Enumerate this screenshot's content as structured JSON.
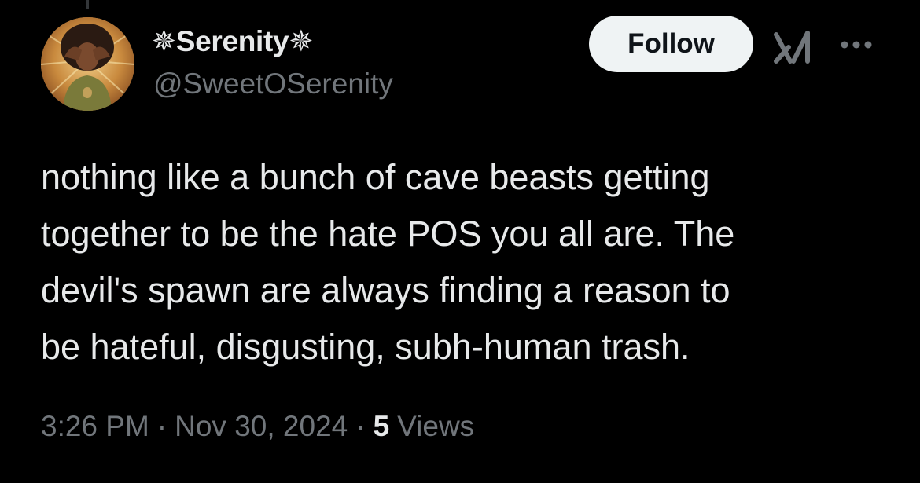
{
  "author": {
    "display_name": "✵Serenity✵",
    "handle": "@SweetOSerenity"
  },
  "actions": {
    "follow_label": "Follow",
    "grok_icon": "grok-icon",
    "more_icon": "more-icon"
  },
  "tweet": {
    "text": "nothing like a bunch of cave beasts getting\ntogether to be the hate POS you all are. The\ndevil's spawn are always finding a reason to\nbe hateful, disgusting, subh-human trash."
  },
  "meta": {
    "time": "3:26 PM",
    "separator": "·",
    "date": "Nov 30, 2024",
    "views_count": "5",
    "views_label": "Views"
  },
  "colors": {
    "background": "#000000",
    "primary_text": "#e7e9ea",
    "secondary_text": "#71767b",
    "follow_bg": "#eff3f4"
  }
}
